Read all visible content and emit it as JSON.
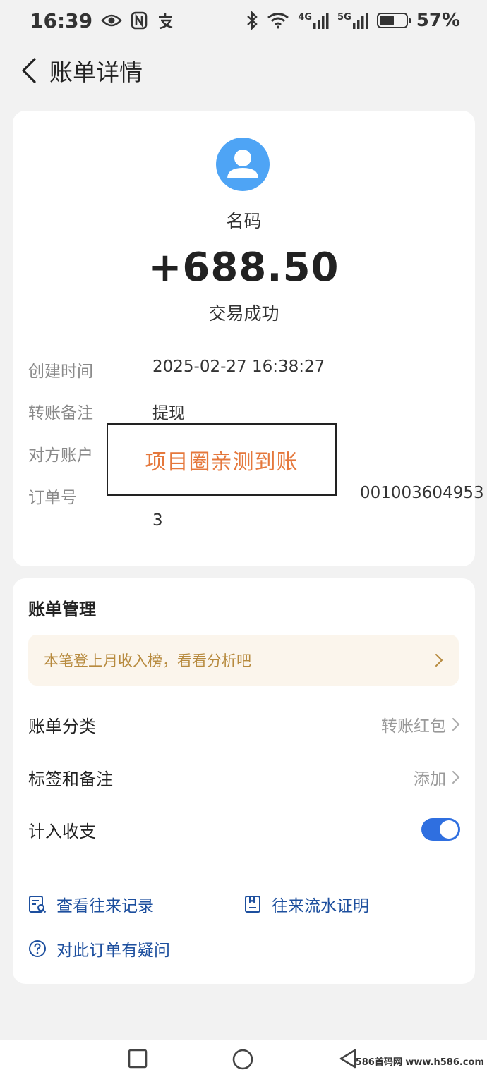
{
  "status_bar": {
    "time": "16:39",
    "network_4g": "4G",
    "network_5g": "5G",
    "battery_level": 0.57,
    "battery_text": "57%",
    "icons": [
      "eye-icon",
      "nfc-icon",
      "alipay-icon",
      "bluetooth-icon",
      "wifi-icon",
      "signal-icon",
      "battery-icon"
    ]
  },
  "header": {
    "title": "账单详情"
  },
  "summary": {
    "payee_name": "名码",
    "amount": "+688.50",
    "status": "交易成功"
  },
  "details": {
    "created_label": "创建时间",
    "created_value": "2025-02-27 16:38:27",
    "remark_label": "转账备注",
    "remark_value": "提现",
    "account_label": "对方账户",
    "order_label": "订单号",
    "order_visible_tail": "001003604953",
    "order_wrap": "3"
  },
  "overlay": {
    "text": "项目圈亲测到账"
  },
  "management": {
    "title": "账单管理",
    "promo_text": "本笔登上月收入榜，看看分析吧",
    "category_label": "账单分类",
    "category_value": "转账红包",
    "tags_label": "标签和备注",
    "tags_value": "添加",
    "include_label": "计入收支",
    "include_on": true,
    "link_history": "查看往来记录",
    "link_proof": "往来流水证明",
    "link_question": "对此订单有疑问"
  },
  "footer": {
    "site_mark": "586首码网 www.h586.com"
  },
  "colors": {
    "accent_blue": "#2f6fe0",
    "avatar_blue": "#4ea4f5",
    "promo_bg": "#fbf5ec",
    "promo_text": "#b78a3e",
    "overlay_text": "#e5783c",
    "link_text": "#1d4f9e"
  }
}
